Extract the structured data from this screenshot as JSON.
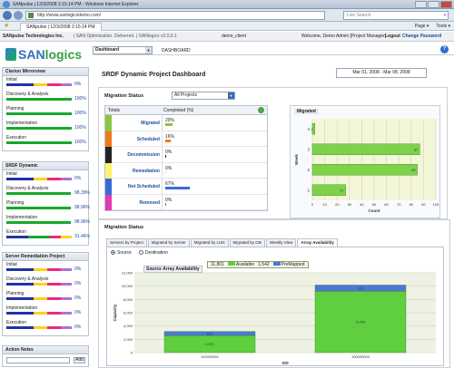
{
  "browser": {
    "window_title": "SANpulse | 12/3/2008 2:15:14 PM - Windows Internet Explorer",
    "url": "http://www.sanlogicsdemo.com/",
    "search_placeholder": "Live Search",
    "tab_title": "SANpulse | 12/3/2008 2:15:14 PM",
    "tools": [
      "Page ▾",
      "Tools ▾"
    ]
  },
  "app_header": {
    "company": "SANpulse Technologies Inc.",
    "tagline": "| SAN Optimization. Delivered. | SANlogics v2.0.0.1",
    "client": "demo_client",
    "welcome": "Welcome, Demo Admin [Project Manager]",
    "logout": "Logout",
    "change_password": "Change Password"
  },
  "logo": {
    "part1": "SAN",
    "part2": "logics"
  },
  "nav": {
    "dashboard_select": "Dashboard",
    "breadcrumb": "DASHBOARD",
    "help": "?"
  },
  "sidebar": {
    "panels": [
      {
        "title": "Clarion Mirrorview",
        "items": [
          {
            "label": "Initial",
            "pct": "0%",
            "segments": [
              [
                "#2233aa",
                30
              ],
              [
                "#ffd21a",
                15
              ],
              [
                "#ee2a7b",
                15
              ],
              [
                "#b070d8",
                12
              ]
            ]
          },
          {
            "label": "Discovery & Analysis",
            "pct": "100%",
            "segments": [
              [
                "#17a82b",
                72
              ]
            ]
          },
          {
            "label": "Planning",
            "pct": "100%",
            "segments": [
              [
                "#17a82b",
                72
              ]
            ]
          },
          {
            "label": "Implementation",
            "pct": "100%",
            "segments": [
              [
                "#17a82b",
                72
              ]
            ]
          },
          {
            "label": "Execution",
            "pct": "100%",
            "segments": [
              [
                "#17a82b",
                72
              ]
            ]
          }
        ]
      },
      {
        "title": "SRDF Dynamic",
        "items": [
          {
            "label": "Initial",
            "pct": "0%",
            "segments": [
              [
                "#2233aa",
                30
              ],
              [
                "#ffd21a",
                15
              ],
              [
                "#ee2a7b",
                15
              ],
              [
                "#b070d8",
                12
              ]
            ]
          },
          {
            "label": "Discovery & Analysis",
            "pct": "98.39%",
            "segments": [
              [
                "#17a82b",
                71
              ]
            ]
          },
          {
            "label": "Planning",
            "pct": "98.96%",
            "segments": [
              [
                "#17a82b",
                71
              ]
            ]
          },
          {
            "label": "Implementation",
            "pct": "98.96%",
            "segments": [
              [
                "#17a82b",
                71
              ]
            ]
          },
          {
            "label": "Execution",
            "pct": "31.46%",
            "segments": [
              [
                "#2233aa",
                24
              ],
              [
                "#17a82b",
                24
              ],
              [
                "#ee2a7b",
                12
              ],
              [
                "#ffd21a",
                12
              ]
            ]
          }
        ]
      },
      {
        "title": "Server Remediation Project",
        "items": [
          {
            "label": "Initial",
            "pct": "0%",
            "segments": [
              [
                "#2233aa",
                30
              ],
              [
                "#ffd21a",
                15
              ],
              [
                "#ee2a7b",
                15
              ],
              [
                "#b070d8",
                12
              ]
            ]
          },
          {
            "label": "Discovery & Analysis",
            "pct": "0%",
            "segments": [
              [
                "#2233aa",
                30
              ],
              [
                "#ffd21a",
                15
              ],
              [
                "#ee2a7b",
                15
              ],
              [
                "#b070d8",
                12
              ]
            ]
          },
          {
            "label": "Planning",
            "pct": "0%",
            "segments": [
              [
                "#2233aa",
                30
              ],
              [
                "#ffd21a",
                15
              ],
              [
                "#ee2a7b",
                15
              ],
              [
                "#b070d8",
                12
              ]
            ]
          },
          {
            "label": "Implementation",
            "pct": "0%",
            "segments": [
              [
                "#2233aa",
                30
              ],
              [
                "#ffd21a",
                15
              ],
              [
                "#ee2a7b",
                15
              ],
              [
                "#b070d8",
                12
              ]
            ]
          },
          {
            "label": "Execution",
            "pct": "0%",
            "segments": [
              [
                "#2233aa",
                30
              ],
              [
                "#ffd21a",
                15
              ],
              [
                "#ee2a7b",
                15
              ],
              [
                "#b070d8",
                12
              ]
            ]
          }
        ]
      }
    ],
    "action_notes": {
      "title": "Action Notes",
      "add_label": "Add"
    }
  },
  "main": {
    "title": "SRDF Dynamic Project Dashboard",
    "date_range": "Mar 01, 2008 - Mar 08, 2008",
    "migration_status": {
      "header": "Migration Status",
      "project_select": "All Projects",
      "col_totals": "Totals",
      "col_completed": "Completed (%)",
      "rows": [
        {
          "name": "Migrated",
          "pct": "20%",
          "color": "#8cc640",
          "bar_color": "#8cc640",
          "bar": 0.2
        },
        {
          "name": "Scheduled",
          "pct": "16%",
          "color": "#f07a1a",
          "bar_color": "#f07a1a",
          "bar": 0.16
        },
        {
          "name": "Decommission",
          "pct": "0%",
          "color": "#222222",
          "bar_color": "#222222",
          "bar": 0.01
        },
        {
          "name": "Remediation",
          "pct": "0%",
          "color": "#fff36a",
          "bar_color": "#fff36a",
          "bar": 0.01
        },
        {
          "name": "Not Scheduled",
          "pct": "67%",
          "color": "#3a6ad8",
          "bar_color": "#3a6ad8",
          "bar": 0.67
        },
        {
          "name": "Removed",
          "pct": "0%",
          "color": "#e23ab0",
          "bar_color": "#e23ab0",
          "bar": 0.01
        }
      ]
    },
    "migration_status_tabs": {
      "header": "Migration Status",
      "tabs": [
        "Servers by Project",
        "Migrated by Server",
        "Migrated by LUN",
        "Migrated by GB",
        "Weekly View",
        "Array Availability"
      ],
      "active_tab": "Array Availability",
      "radio_source": "Source",
      "radio_destination": "Destination",
      "legend_available_value": "11,801",
      "legend_available_label": "Available",
      "legend_premapped_value": "1,542",
      "legend_premapped_label": "PreMapped",
      "chart_title": "Source Array Availability"
    }
  },
  "chart_data": [
    {
      "type": "bar",
      "orientation": "horizontal",
      "title": "Migrated",
      "xlabel": "Count",
      "ylabel": "Week",
      "categories": [
        "1",
        "2",
        "3",
        "4"
      ],
      "values": [
        27,
        85,
        87,
        2
      ],
      "xlim": [
        0,
        100
      ],
      "xticks": [
        0,
        10,
        20,
        30,
        40,
        50,
        60,
        70,
        80,
        90,
        100
      ],
      "grid": true
    },
    {
      "type": "bar",
      "stacked": true,
      "title": "Source Array Availability",
      "xlabel": "SID",
      "ylabel": "Capacity",
      "categories": [
        "100000001",
        "100000003"
      ],
      "series": [
        {
          "name": "Available",
          "values": [
            2571,
            9230
          ],
          "color": "#5fcf3f"
        },
        {
          "name": "PreMapped",
          "values": [
            611,
            931
          ],
          "color": "#4a78d8"
        }
      ],
      "ylim": [
        0,
        12000
      ],
      "yticks": [
        0,
        2000,
        4000,
        6000,
        8000,
        10000,
        12000
      ],
      "legend": "top"
    }
  ]
}
